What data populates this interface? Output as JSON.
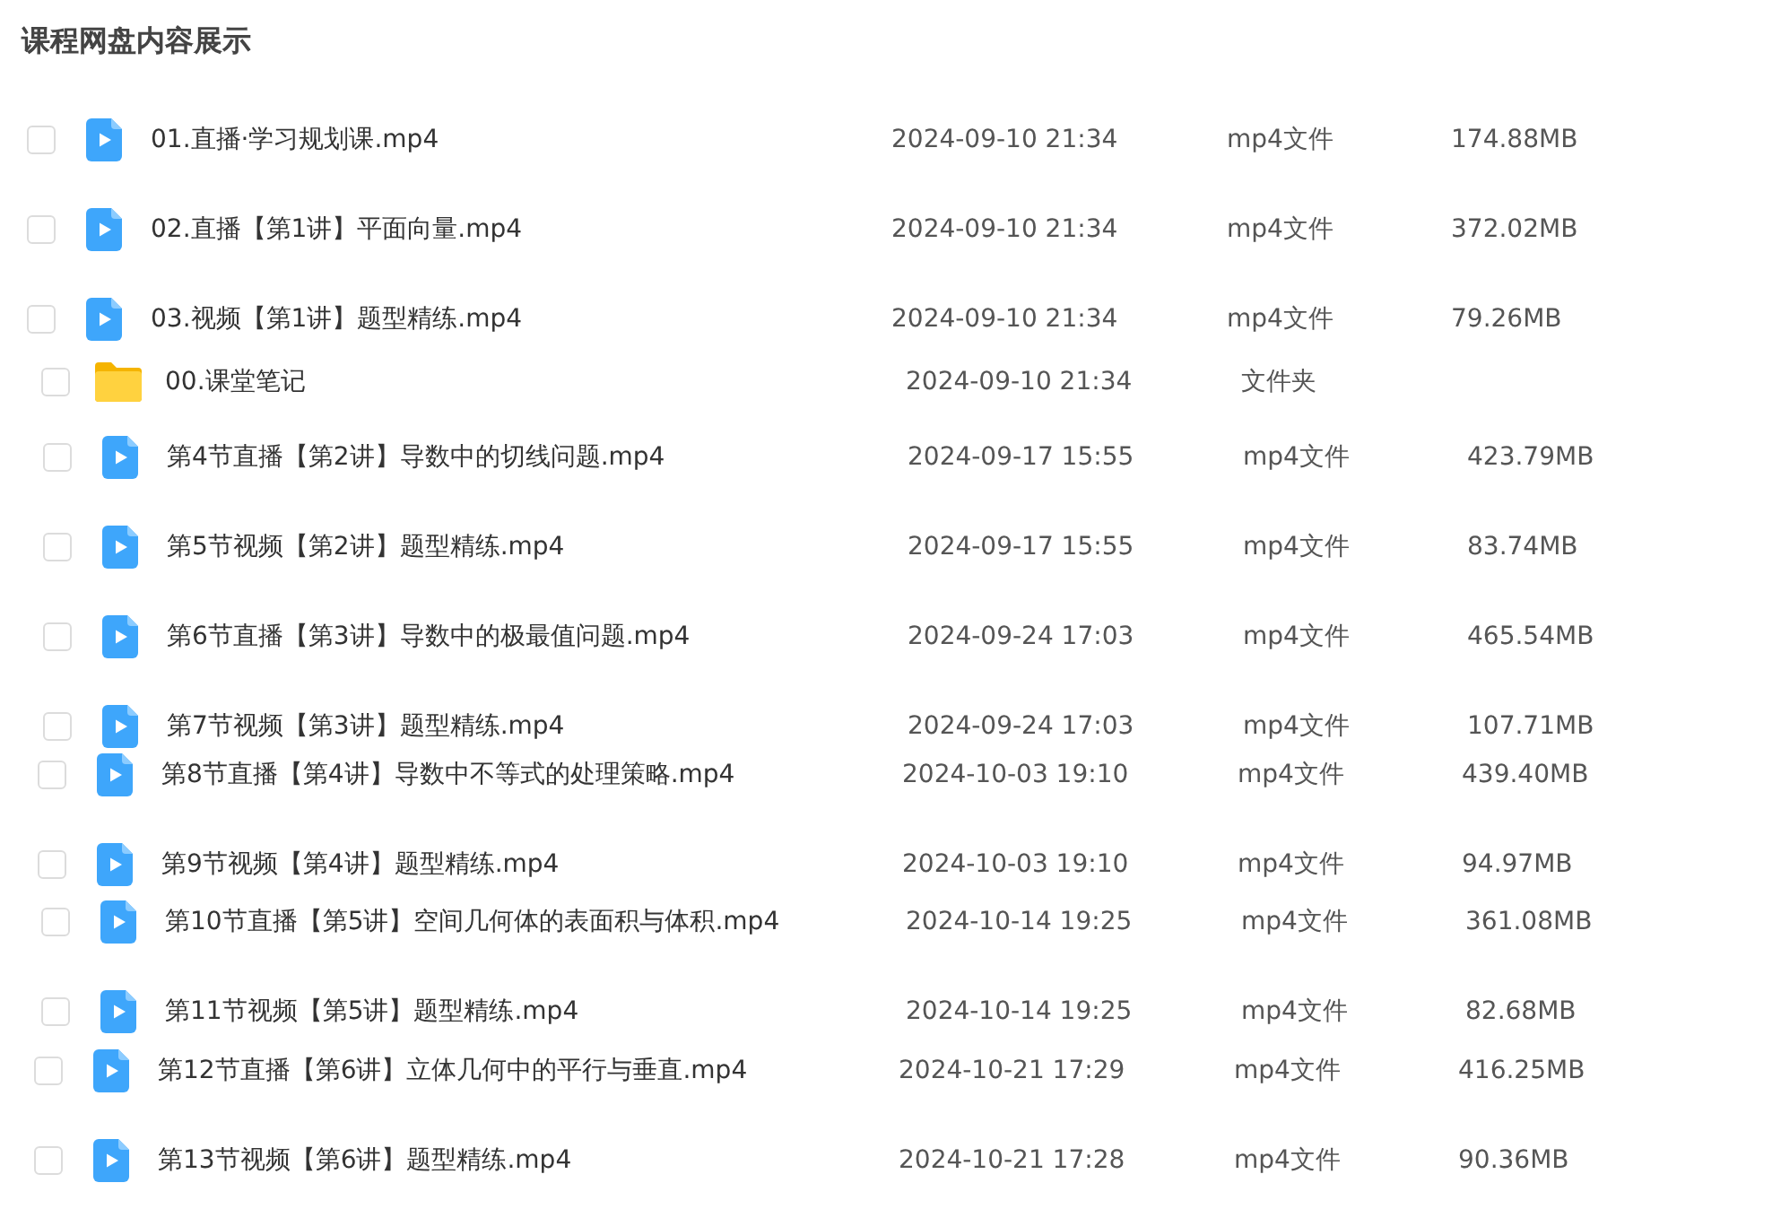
{
  "title": "课程网盘内容展示",
  "files": [
    {
      "kind": "video",
      "checked": false,
      "name": "01.直播·学习规划课.mp4",
      "modified": "2024-09-10 21:34",
      "type": "mp4文件",
      "size": "174.88MB"
    },
    {
      "kind": "video",
      "checked": false,
      "name": "02.直播【第1讲】平面向量.mp4",
      "modified": "2024-09-10 21:34",
      "type": "mp4文件",
      "size": "372.02MB"
    },
    {
      "kind": "video",
      "checked": false,
      "name": "03.视频【第1讲】题型精练.mp4",
      "modified": "2024-09-10 21:34",
      "type": "mp4文件",
      "size": "79.26MB"
    },
    {
      "kind": "folder",
      "checked": false,
      "name": "00.课堂笔记",
      "modified": "2024-09-10 21:34",
      "type": "文件夹"
    },
    {
      "kind": "video",
      "checked": false,
      "name": "第4节直播【第2讲】导数中的切线问题.mp4",
      "modified": "2024-09-17 15:55",
      "type": "mp4文件",
      "size": "423.79MB"
    },
    {
      "kind": "video",
      "checked": false,
      "name": "第5节视频【第2讲】题型精练.mp4",
      "modified": "2024-09-17 15:55",
      "type": "mp4文件",
      "size": "83.74MB"
    },
    {
      "kind": "video",
      "checked": false,
      "name": "第6节直播【第3讲】导数中的极最值问题.mp4",
      "modified": "2024-09-24 17:03",
      "type": "mp4文件",
      "size": "465.54MB"
    },
    {
      "kind": "video",
      "checked": false,
      "name": "第7节视频【第3讲】题型精练.mp4",
      "modified": "2024-09-24 17:03",
      "type": "mp4文件",
      "size": "107.71MB"
    },
    {
      "kind": "video",
      "checked": false,
      "name": "第8节直播【第4讲】导数中不等式的处理策略.mp4",
      "modified": "2024-10-03 19:10",
      "type": "mp4文件",
      "size": "439.40MB"
    },
    {
      "kind": "video",
      "checked": false,
      "name": "第9节视频【第4讲】题型精练.mp4",
      "modified": "2024-10-03 19:10",
      "type": "mp4文件",
      "size": "94.97MB"
    },
    {
      "kind": "video",
      "checked": false,
      "name": "第10节直播【第5讲】空间几何体的表面积与体积.mp4",
      "modified": "2024-10-14 19:25",
      "type": "mp4文件",
      "size": "361.08MB"
    },
    {
      "kind": "video",
      "checked": false,
      "name": "第11节视频【第5讲】题型精练.mp4",
      "modified": "2024-10-14 19:25",
      "type": "mp4文件",
      "size": "82.68MB"
    },
    {
      "kind": "video",
      "checked": false,
      "name": "第12节直播【第6讲】立体几何中的平行与垂直.mp4",
      "modified": "2024-10-21 17:29",
      "type": "mp4文件",
      "size": "416.25MB"
    },
    {
      "kind": "video",
      "checked": false,
      "name": "第13节视频【第6讲】题型精练.mp4",
      "modified": "2024-10-21 17:28",
      "type": "mp4文件",
      "size": "90.36MB"
    }
  ]
}
